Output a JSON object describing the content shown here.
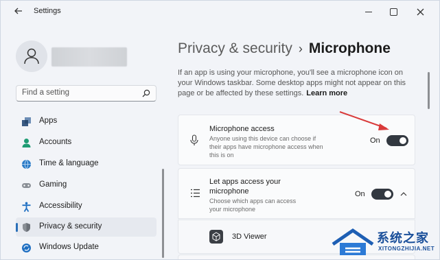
{
  "window": {
    "title": "Settings",
    "back_icon": "back-arrow-icon"
  },
  "sidebar": {
    "search_placeholder": "Find a setting",
    "items": [
      {
        "label": "Apps",
        "icon": "apps-icon",
        "color": "#3a5a82"
      },
      {
        "label": "Accounts",
        "icon": "accounts-icon",
        "color": "#1f9c74"
      },
      {
        "label": "Time & language",
        "icon": "time-language-icon",
        "color": "#2b7bc7"
      },
      {
        "label": "Gaming",
        "icon": "gaming-icon",
        "color": "#8a8f96"
      },
      {
        "label": "Accessibility",
        "icon": "accessibility-icon",
        "color": "#1f6fc2"
      },
      {
        "label": "Privacy & security",
        "icon": "shield-icon",
        "color": "#8a8f96",
        "active": true
      },
      {
        "label": "Windows Update",
        "icon": "windows-update-icon",
        "color": "#1f6fc2"
      }
    ]
  },
  "main": {
    "breadcrumb_parent": "Privacy & security",
    "breadcrumb_separator": "›",
    "breadcrumb_current": "Microphone",
    "description": "If an app is using your microphone, you'll see a microphone icon on your Windows taskbar. Some desktop apps might not appear on this page or be affected by these settings.",
    "learn_more": "Learn more",
    "microphone_access": {
      "title": "Microphone access",
      "subtitle": "Anyone using this device can choose if their apps have microphone access when this is on",
      "state_label": "On"
    },
    "let_apps_access": {
      "title": "Let apps access your microphone",
      "subtitle": "Choose which apps can access your microphone",
      "state_label": "On"
    },
    "apps": [
      {
        "name": "3D Viewer"
      }
    ]
  },
  "watermark": {
    "text": "系统之家",
    "url": "XITONGZHIJIA.NET"
  },
  "colors": {
    "accent": "#2a6fb8",
    "toggle_on": "#323840",
    "annotation_arrow": "#d93a3a"
  }
}
